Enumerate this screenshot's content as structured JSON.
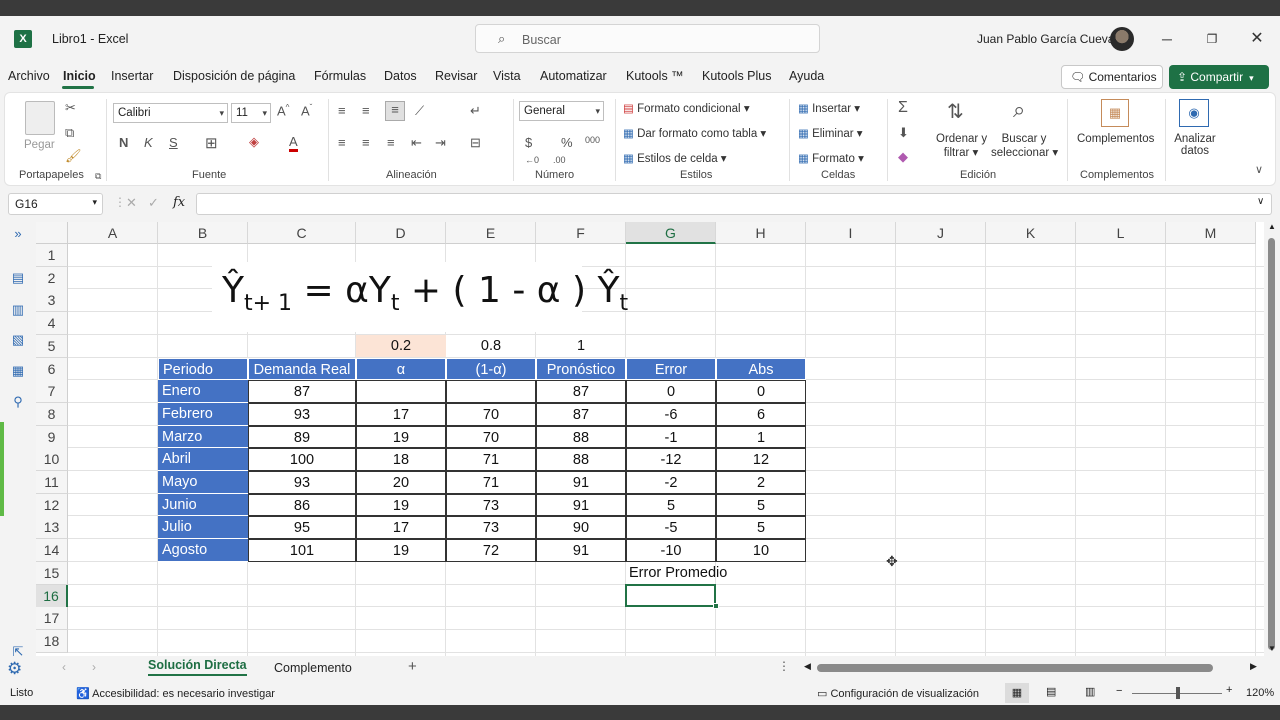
{
  "titlebar": {
    "doc_title": "Libro1  -  Excel",
    "search_placeholder": "Buscar",
    "user_name": "Juan Pablo García Cuevas"
  },
  "menu": [
    "Archivo",
    "Inicio",
    "Insertar",
    "Disposición de página",
    "Fórmulas",
    "Datos",
    "Revisar",
    "Vista",
    "Automatizar",
    "Kutools ™",
    "Kutools Plus",
    "Ayuda"
  ],
  "menu_right": {
    "comments": "Comentarios",
    "share": "Compartir"
  },
  "ribbon": {
    "groups": [
      "Portapapeles",
      "Fuente",
      "Alineación",
      "Número",
      "Estilos",
      "Celdas",
      "Edición",
      "Complementos"
    ],
    "paste": "Pegar",
    "font_name": "Calibri",
    "font_size": "11",
    "bold": "N",
    "italic": "K",
    "underline": "S",
    "number_format": "General",
    "cond_format": "Formato condicional",
    "format_table": "Dar formato como tabla",
    "cell_styles": "Estilos de celda",
    "insert": "Insertar",
    "delete": "Eliminar",
    "format": "Formato",
    "sort_1": "Ordenar y",
    "sort_2": "filtrar",
    "find_1": "Buscar y",
    "find_2": "seleccionar",
    "addins": "Complementos",
    "analyze_1": "Analizar",
    "analyze_2": "datos"
  },
  "formula_bar": {
    "name_box": "G16",
    "fx": "fx",
    "content": ""
  },
  "columns": [
    "A",
    "B",
    "C",
    "D",
    "E",
    "F",
    "G",
    "H",
    "I",
    "J",
    "K",
    "L",
    "M"
  ],
  "rows": [
    "1",
    "2",
    "3",
    "4",
    "5",
    "6",
    "7",
    "8",
    "9",
    "10",
    "11",
    "12",
    "13",
    "14",
    "15",
    "16",
    "17",
    "18"
  ],
  "formula_text": {
    "main": "Ŷ",
    "sub1": "t+ 1",
    "eq": " = αY",
    "sub2": "t",
    "mid": " + ( 1 - α ) Ŷ",
    "sub3": "t"
  },
  "params": {
    "alpha": "0.2",
    "one_minus_alpha": "0.8",
    "one": "1"
  },
  "table": {
    "headers": [
      "Periodo",
      "Demanda Real",
      "α",
      "(1-α)",
      "Pronóstico",
      "Error",
      "Abs"
    ],
    "rows": [
      [
        "Enero",
        "87",
        "",
        "",
        "87",
        "0",
        "0"
      ],
      [
        "Febrero",
        "93",
        "17",
        "70",
        "87",
        "-6",
        "6"
      ],
      [
        "Marzo",
        "89",
        "19",
        "70",
        "88",
        "-1",
        "1"
      ],
      [
        "Abril",
        "100",
        "18",
        "71",
        "88",
        "-12",
        "12"
      ],
      [
        "Mayo",
        "93",
        "20",
        "71",
        "91",
        "-2",
        "2"
      ],
      [
        "Junio",
        "86",
        "19",
        "73",
        "91",
        "5",
        "5"
      ],
      [
        "Julio",
        "95",
        "17",
        "73",
        "90",
        "-5",
        "5"
      ],
      [
        "Agosto",
        "101",
        "19",
        "72",
        "91",
        "-10",
        "10"
      ]
    ]
  },
  "error_label": "Error Promedio",
  "sheets": {
    "active": "Solución Directa",
    "other": "Complemento"
  },
  "status": {
    "mode": "Listo",
    "accessibility": "Accesibilidad: es necesario investigar",
    "display_settings": "Configuración de visualización",
    "zoom": "120%"
  },
  "colors": {
    "accent": "#217346",
    "header_fill": "#4472c4",
    "alpha_fill": "#fce4d6"
  }
}
